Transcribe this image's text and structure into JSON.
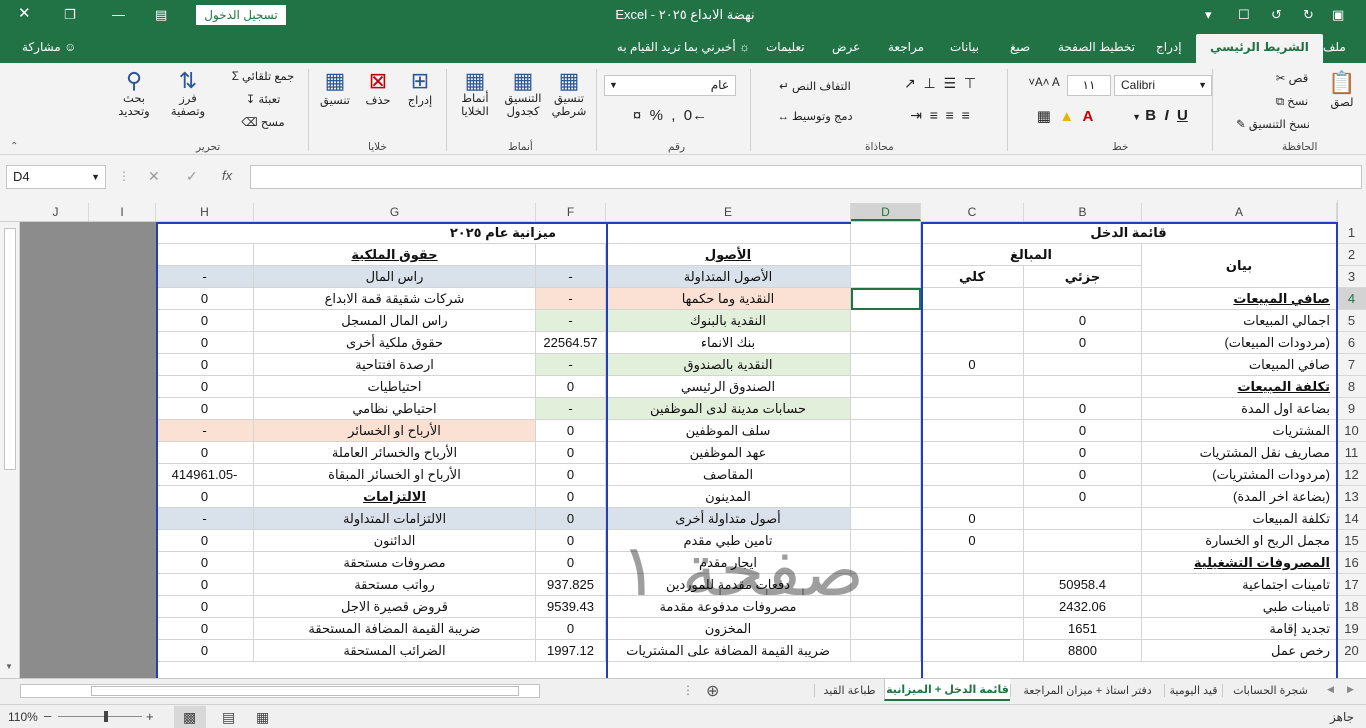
{
  "window": {
    "title": "نهضة الابداع ٢٠٢٥  -  Excel",
    "signin": "تسجيل الدخول"
  },
  "tabs": [
    "ملف",
    "الشريط الرئيسي",
    "إدراج",
    "تخطيط الصفحة",
    "صيغ",
    "بيانات",
    "مراجعة",
    "عرض",
    "تعليمات"
  ],
  "tellme": "أخبرني بما تريد القيام به",
  "share": "مشاركة",
  "ribbon": {
    "clipboard": {
      "paste": "لصق",
      "cut": "قص",
      "copy": "نسخ",
      "painter": "نسخ التنسيق",
      "label": "الحافظة"
    },
    "font": {
      "name": "Calibri",
      "size": "١١",
      "label": "خط"
    },
    "alignment": {
      "wrap": "التفاف النص",
      "merge": "دمج وتوسيط",
      "label": "محاذاة"
    },
    "number": {
      "format": "عام",
      "label": "رقم"
    },
    "styles": {
      "conditional": "تنسيق\nشرطي",
      "table": "التنسيق\nكجدول",
      "cell": "أنماط\nالخلايا",
      "label": "أنماط"
    },
    "cells": {
      "insert": "إدراج",
      "delete": "حذف",
      "format": "تنسيق",
      "label": "خلايا"
    },
    "editing": {
      "autosum": "جمع تلقائي",
      "fill": "تعبئة",
      "clear": "مسح",
      "sort": "فرز\nوتصفية",
      "find": "بحث\nوتحديد",
      "label": "تحرير"
    }
  },
  "formula_bar": {
    "namebox": "D4",
    "fx": "fx",
    "value": ""
  },
  "columns": [
    {
      "id": "A",
      "w": 195,
      "label": "A"
    },
    {
      "id": "B",
      "w": 118,
      "label": "B"
    },
    {
      "id": "C",
      "w": 103,
      "label": "C"
    },
    {
      "id": "D",
      "w": 70,
      "label": "D"
    },
    {
      "id": "E",
      "w": 245,
      "label": "E"
    },
    {
      "id": "F",
      "w": 70,
      "label": "F"
    },
    {
      "id": "G",
      "w": 282,
      "label": "G"
    },
    {
      "id": "H",
      "w": 98,
      "label": "H"
    },
    {
      "id": "I",
      "w": 67,
      "label": "I"
    },
    {
      "id": "J",
      "w": 66,
      "label": "J"
    }
  ],
  "rows": [
    "1",
    "2",
    "3",
    "4",
    "5",
    "6",
    "7",
    "8",
    "9",
    "10",
    "11",
    "12",
    "13",
    "14",
    "15",
    "16",
    "17",
    "18",
    "19",
    "20"
  ],
  "cells": {
    "A1": "قائمة الدخل",
    "A2": "بيان",
    "B2": "المبالغ",
    "B3": "جزئي",
    "C3": "كلي",
    "A4": "صافي المبيعات",
    "A5": "اجمالي المبيعات",
    "B5": "0",
    "A6": "(مردودات المبيعات)",
    "B6": "0",
    "A7": "صافي المبيعات",
    "C7": "0",
    "A8": "تكلفة المبيعات",
    "A9": "بضاعة اول المدة",
    "B9": "0",
    "A10": "المشتريات",
    "B10": "0",
    "A11": "مصاريف نقل المشتريات",
    "B11": "0",
    "A12": "(مردودات المشتريات)",
    "B12": "0",
    "A13": "(بضاعة اخر المدة)",
    "B13": "0",
    "A14": "تكلفة المبيعات",
    "C14": "0",
    "A15": "مجمل الربح او الخسارة",
    "C15": "0",
    "A16": "المصروفات التشغيلية",
    "A17": "تامينات اجتماعية",
    "B17": "50958.4",
    "A18": "تامينات طبي",
    "B18": "2432.06",
    "A19": "تجديد إقامة",
    "B19": "1651",
    "A20": "رخص عمل",
    "B20": "8800",
    "E1": "ميزانية عام ٢٠٢٥",
    "E2": "الأصول",
    "G2": "حقوق الملكية",
    "E3": "الأصول المتداولة",
    "F3": "-",
    "G3": "راس المال",
    "H3": "-",
    "E4": "النقدية وما حكمها",
    "F4": "-",
    "G4": "شركات شقيقة قمة الابداع",
    "H4": "0",
    "E5": "النقدية بالبنوك",
    "F5": "-",
    "G5": "راس المال المسجل",
    "H5": "0",
    "E6": "بنك الانماء",
    "F6": "22564.57",
    "G6": "حقوق ملكية أخرى",
    "H6": "0",
    "E7": "النقدية بالصندوق",
    "F7": "-",
    "G7": "ارصدة افتتاحية",
    "H7": "0",
    "E8": "الصندوق الرئيسي",
    "F8": "0",
    "G8": "احتياطيات",
    "H8": "0",
    "E9": "حسابات مدينة لدى الموظفين",
    "F9": "-",
    "G9": "احتياطي نظامي",
    "H9": "0",
    "E10": "سلف الموظفين",
    "F10": "0",
    "G10": "الأرباح او الخسائر",
    "H10": "-",
    "E11": "عهد الموظفين",
    "F11": "0",
    "G11": "الأرباح والخسائر العاملة",
    "H11": "0",
    "E12": "المقاصف",
    "F12": "0",
    "G12": "الأرباح او الخسائر المبقاة",
    "H12": "-414961.05",
    "E13": "المدينون",
    "F13": "0",
    "G13": "الالتزامات",
    "H13": "0",
    "E14": "أصول متداولة أخرى",
    "F14": "0",
    "G14": "الالتزامات المتداولة",
    "H14": "-",
    "E15": "تامين طبي مقدم",
    "F15": "0",
    "G15": "الدائنون",
    "H15": "0",
    "E16": "ايجار مقدم",
    "F16": "0",
    "G16": "مصروفات مستحقة",
    "H16": "0",
    "E17": "دفعات مقدمة للموردين",
    "F17": "937.825",
    "G17": "رواتب مستحقة",
    "H17": "0",
    "E18": "مصروفات مدفوعة مقدمة",
    "F18": "9539.43",
    "G18": "قروض قصيرة الاجل",
    "H18": "0",
    "E19": "المخزون",
    "F19": "0",
    "G19": "ضريبة القيمة المضافة المستحقة",
    "H19": "0",
    "E20": "ضريبة القيمة المضافة على المشتريات",
    "F20": "1997.12",
    "G20": "الضرائب المستحقة",
    "H20": "0"
  },
  "colors": {
    "green": "#217346",
    "blue_border": "#1f3fbf",
    "grey_fill": "#d9e1ea",
    "peach_fill": "#fbe1d4",
    "green_fill": "#e2efda",
    "dark_area": "#8c8c8c"
  },
  "sheets": [
    {
      "name": "شجرة الحسابات",
      "active": false
    },
    {
      "name": "قيد اليومية",
      "active": false
    },
    {
      "name": "دفتر استاذ + ميزان المراجعة",
      "active": false
    },
    {
      "name": "قائمة الدخل + الميزانية",
      "active": true
    },
    {
      "name": "طباعة القيد",
      "active": false
    }
  ],
  "status": {
    "ready": "جاهز",
    "zoom": "110%"
  },
  "watermark": "صفحة ١"
}
